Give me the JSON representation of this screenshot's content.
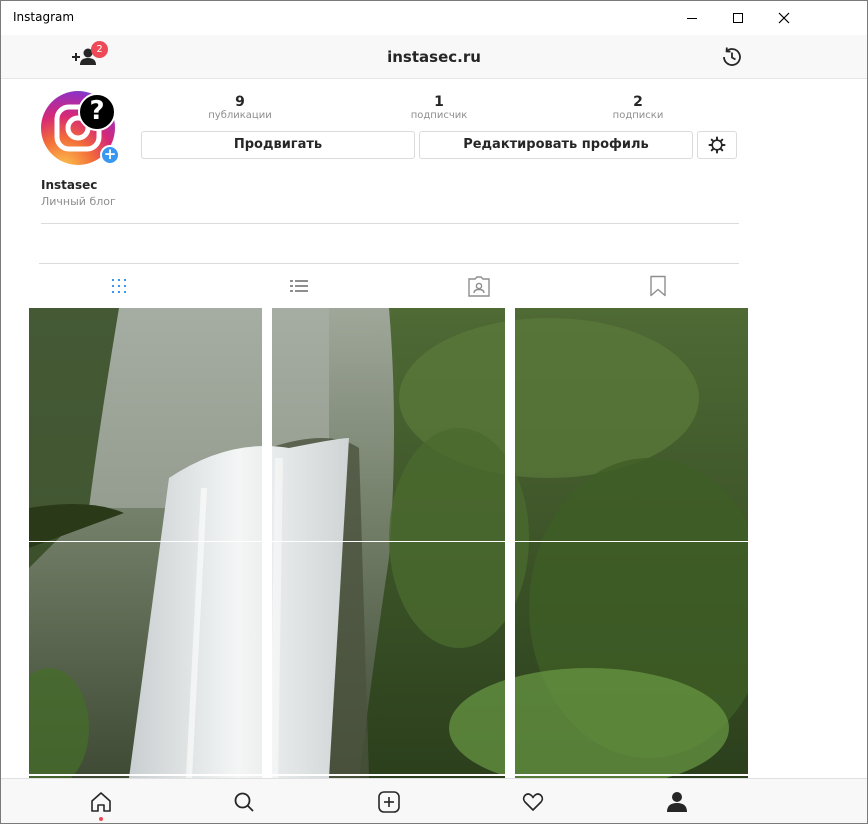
{
  "window": {
    "title": "Instagram"
  },
  "header": {
    "title": "instasec.ru",
    "notification_count": "2"
  },
  "profile": {
    "username": "Instasec",
    "category": "Личный блог",
    "help_glyph": "?",
    "add_glyph": "+"
  },
  "stats": [
    {
      "value": "9",
      "label": "публикации"
    },
    {
      "value": "1",
      "label": "подписчик"
    },
    {
      "value": "2",
      "label": "подписки"
    }
  ],
  "buttons": {
    "promote": "Продвигать",
    "edit_profile": "Редактировать профиль"
  },
  "tabs": [
    {
      "icon": "grid-icon",
      "active": true
    },
    {
      "icon": "list-icon",
      "active": false
    },
    {
      "icon": "tagged-icon",
      "active": false
    },
    {
      "icon": "bookmark-icon",
      "active": false
    }
  ],
  "bottom_nav": [
    {
      "icon": "home-icon",
      "active": true
    },
    {
      "icon": "search-icon",
      "active": false
    },
    {
      "icon": "new-post-icon",
      "active": false
    },
    {
      "icon": "heart-icon",
      "active": false
    },
    {
      "icon": "profile-icon",
      "active": false
    }
  ],
  "colors": {
    "accent_blue": "#3897f0",
    "badge_red": "#ed4956",
    "text_dark": "#262626",
    "text_muted": "#8e8e8e"
  }
}
